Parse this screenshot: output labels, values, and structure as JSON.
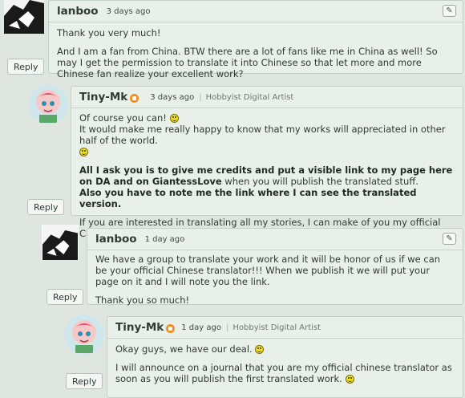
{
  "comments": [
    {
      "username": "lanboo",
      "time": "3 days ago",
      "paragraphs": [
        "Thank you very much!",
        "And I am a fan from China. BTW there are a lot of fans like me in China as well! So may I get the permission to translate it into Chinese so that let more and more Chinese fan realize your excellent work?"
      ],
      "reply_label": "Reply"
    },
    {
      "username": "Tiny-Mk",
      "time": "3 days ago",
      "tagline": "Hobbyist Digital Artist",
      "line1": "Of course you can!",
      "line2": "It would make me really happy to know that my works will appreciated in other half of the world.",
      "bold1": "All I ask you is to give me credits and put a visible link to my page here on DA and on GiantessLove",
      "normal1": " when you will publish the translated stuff.",
      "bold2": "Also you have to note me the link where I can see the translated version.",
      "last": "If you are interested in translating all my stories, I can make of you my official Chinese translator.",
      "reply_label": "Reply"
    },
    {
      "username": "lanboo",
      "time": "1 day ago",
      "paragraphs": [
        "We have a group to translate your work and it will be honor of us if we can be your official Chinese translator!!! When we publish it we will put your page on it and I will note you the link.",
        "Thank you so much!"
      ],
      "reply_label": "Reply"
    },
    {
      "username": "Tiny-Mk",
      "time": "1 day ago",
      "tagline": "Hobbyist Digital Artist",
      "line1": "Okay guys, we have our deal.",
      "line2": "I will announce on a journal that you are my official chinese translator as soon as you will publish the first translated work.",
      "reply_label": "Reply"
    }
  ]
}
